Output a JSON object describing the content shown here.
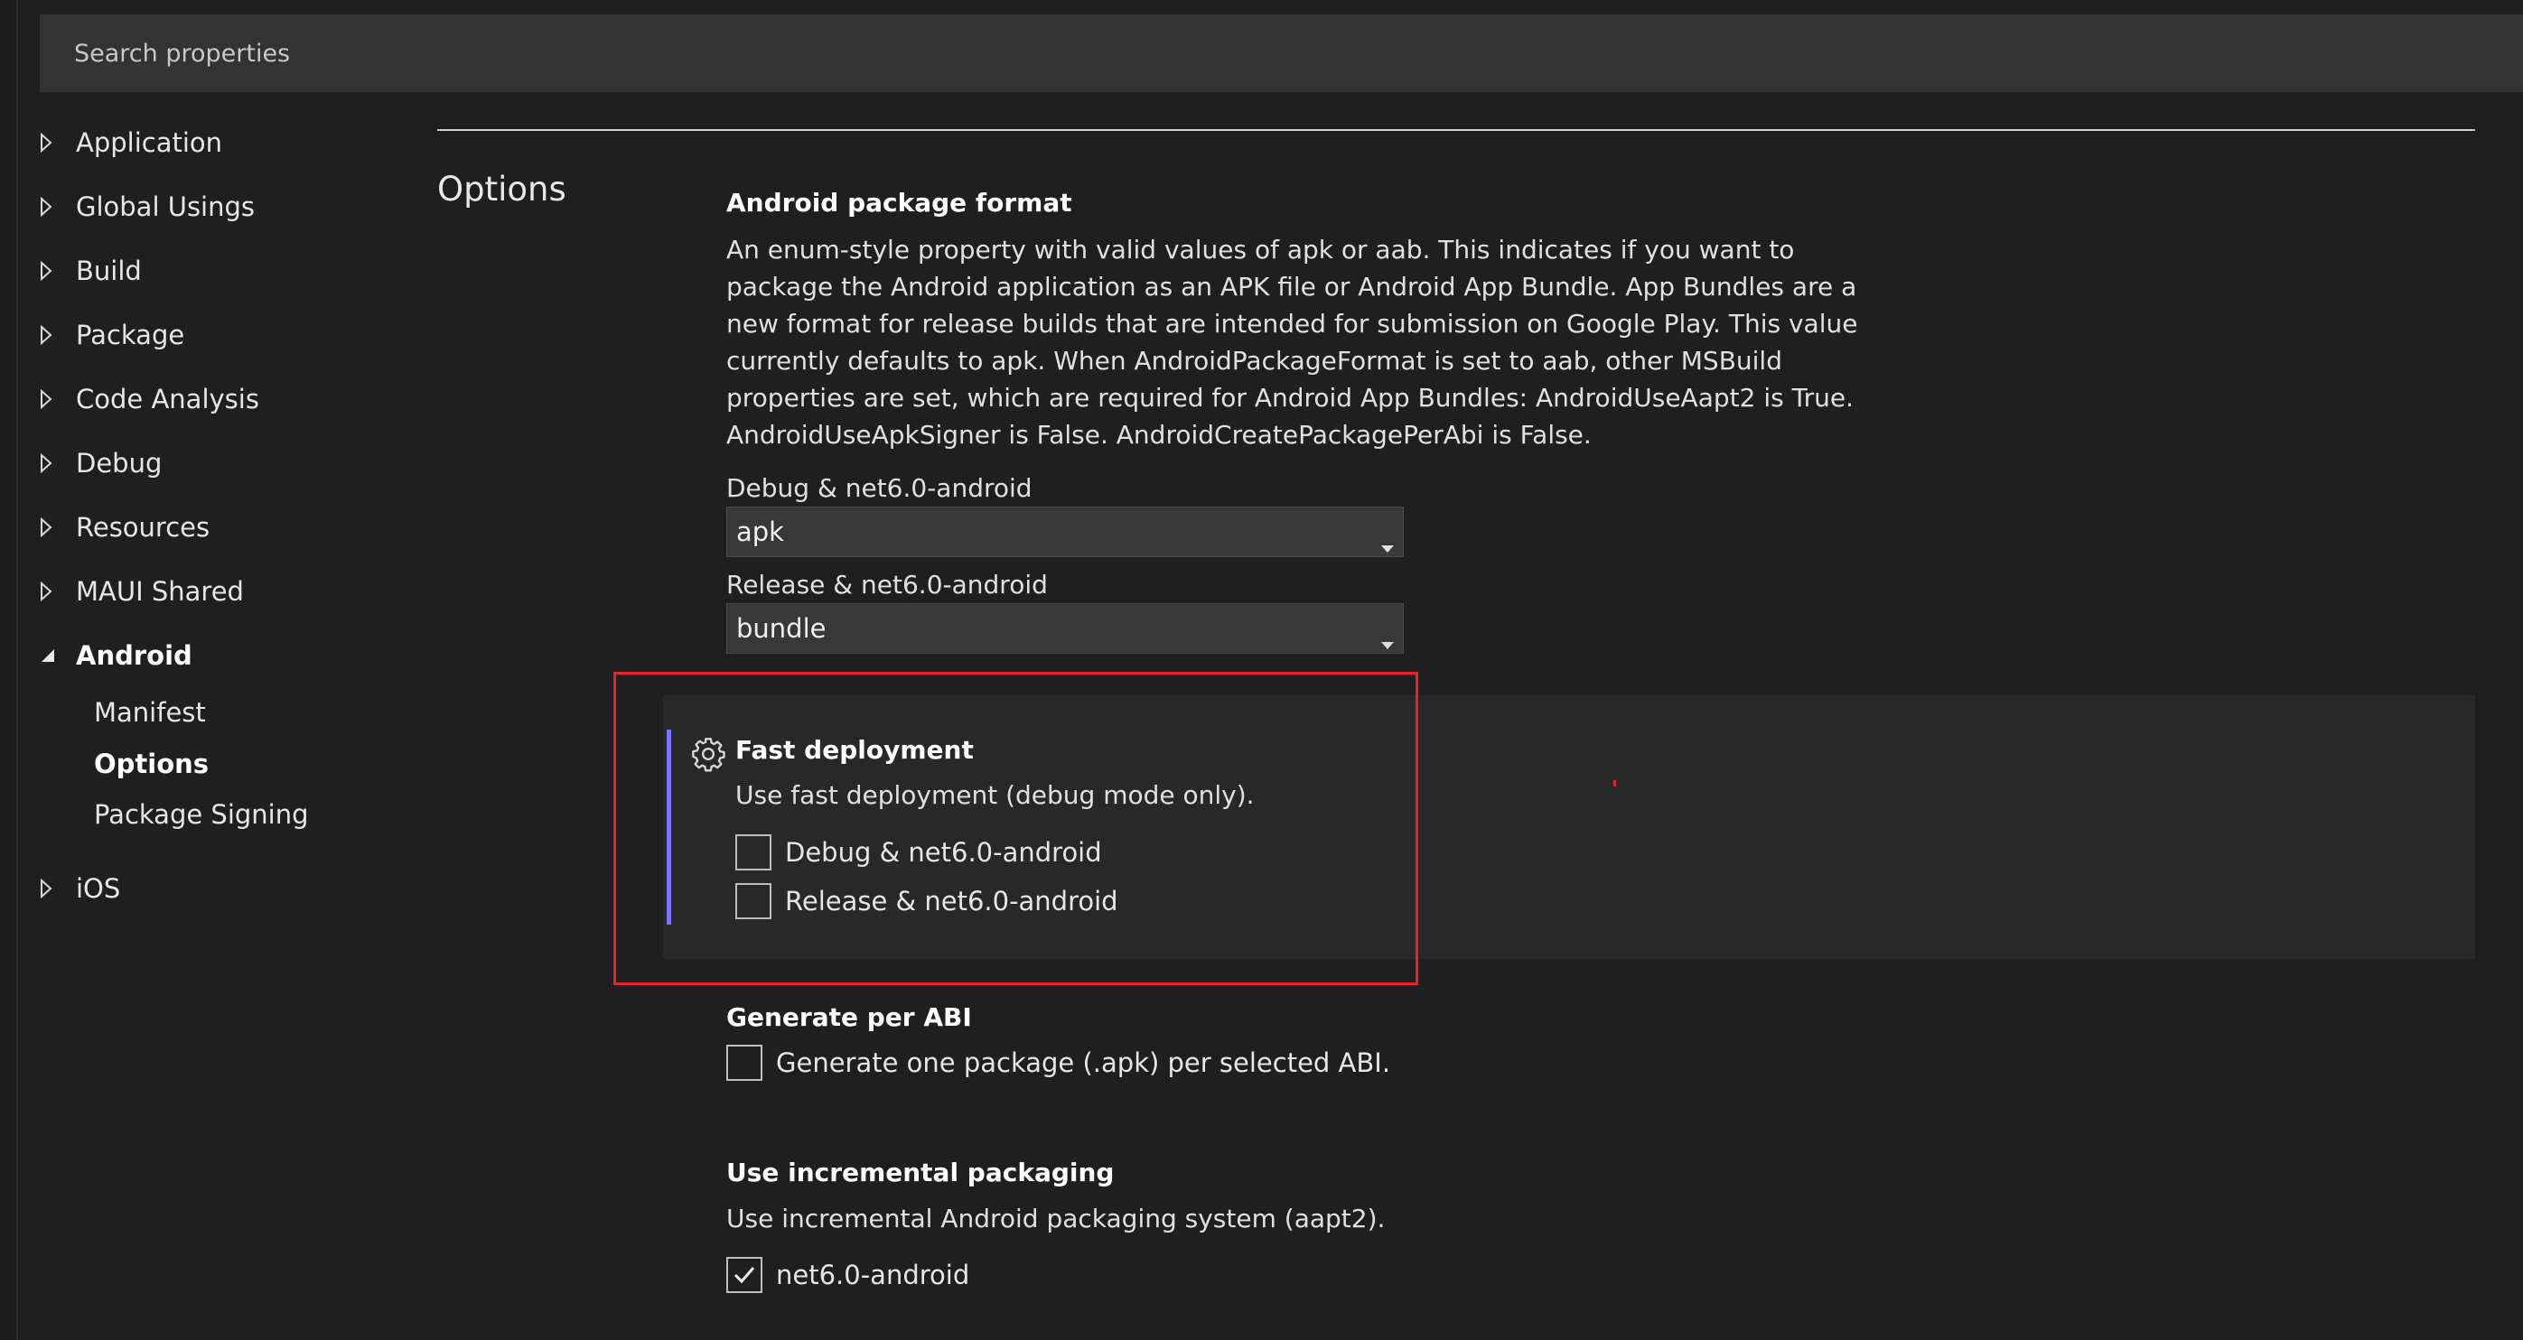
{
  "search": {
    "placeholder": "Search properties"
  },
  "nav": {
    "items": [
      {
        "label": "Application"
      },
      {
        "label": "Global Usings"
      },
      {
        "label": "Build"
      },
      {
        "label": "Package"
      },
      {
        "label": "Code Analysis"
      },
      {
        "label": "Debug"
      },
      {
        "label": "Resources"
      },
      {
        "label": "MAUI Shared"
      },
      {
        "label": "Android",
        "expanded": true
      },
      {
        "label": "iOS"
      }
    ],
    "android_children": [
      {
        "label": "Manifest"
      },
      {
        "label": "Options",
        "selected": true
      },
      {
        "label": "Package Signing"
      }
    ]
  },
  "section": {
    "title": "Options"
  },
  "package_format": {
    "title": "Android package format",
    "description": "An enum-style property with valid values of apk or aab. This indicates if you want to package the Android application as an APK file or Android App Bundle. App Bundles are a new format for release builds that are intended for submission on Google Play. This value currently defaults to apk. When AndroidPackageFormat is set to aab, other MSBuild properties are set, which are required for Android App Bundles: AndroidUseAapt2 is True. AndroidUseApkSigner is False. AndroidCreatePackagePerAbi is False.",
    "debug_label": "Debug & net6.0-android",
    "debug_value": "apk",
    "release_label": "Release & net6.0-android",
    "release_value": "bundle"
  },
  "fast_deployment": {
    "title": "Fast deployment",
    "description": "Use fast deployment (debug mode only).",
    "debug_label": "Debug & net6.0-android",
    "debug_checked": false,
    "release_label": "Release & net6.0-android",
    "release_checked": false
  },
  "per_abi": {
    "title": "Generate per ABI",
    "label": "Generate one package (.apk) per selected ABI.",
    "checked": false
  },
  "incremental": {
    "title": "Use incremental packaging",
    "description": "Use incremental Android packaging system (aapt2).",
    "label": "net6.0-android",
    "checked": true
  },
  "colors": {
    "background": "#1f1f1f",
    "accent": "#7b73ff",
    "highlight": "#e0242b"
  },
  "icons": {
    "collapsed": "triangle-right-icon",
    "expanded": "triangle-down-icon",
    "settings": "gear-icon",
    "dropdown": "chevron-down-icon",
    "check": "checkmark-icon"
  }
}
